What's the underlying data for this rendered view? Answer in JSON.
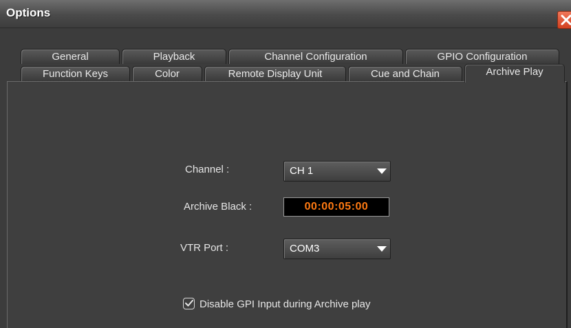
{
  "window": {
    "title": "Options",
    "close_icon": "close-icon"
  },
  "tabs": {
    "row1": [
      "General",
      "Playback",
      "Channel Configuration",
      "GPIO Configuration"
    ],
    "row2": [
      "Function Keys",
      "Color",
      "Remote Display Unit",
      "Cue and Chain",
      "Archive Play"
    ],
    "active": "Archive Play"
  },
  "archive_play": {
    "channel_label": "Channel :",
    "channel_value": "CH 1",
    "archive_black_label": "Archive Black :",
    "archive_black_value": "00:00:05:00",
    "vtr_port_label": "VTR Port :",
    "vtr_port_value": "COM3",
    "disable_gpi_label": "Disable GPI Input during Archive play",
    "disable_gpi_checked": true
  },
  "colors": {
    "timecode": "#ff7a12",
    "close_button": "#e0502f"
  }
}
